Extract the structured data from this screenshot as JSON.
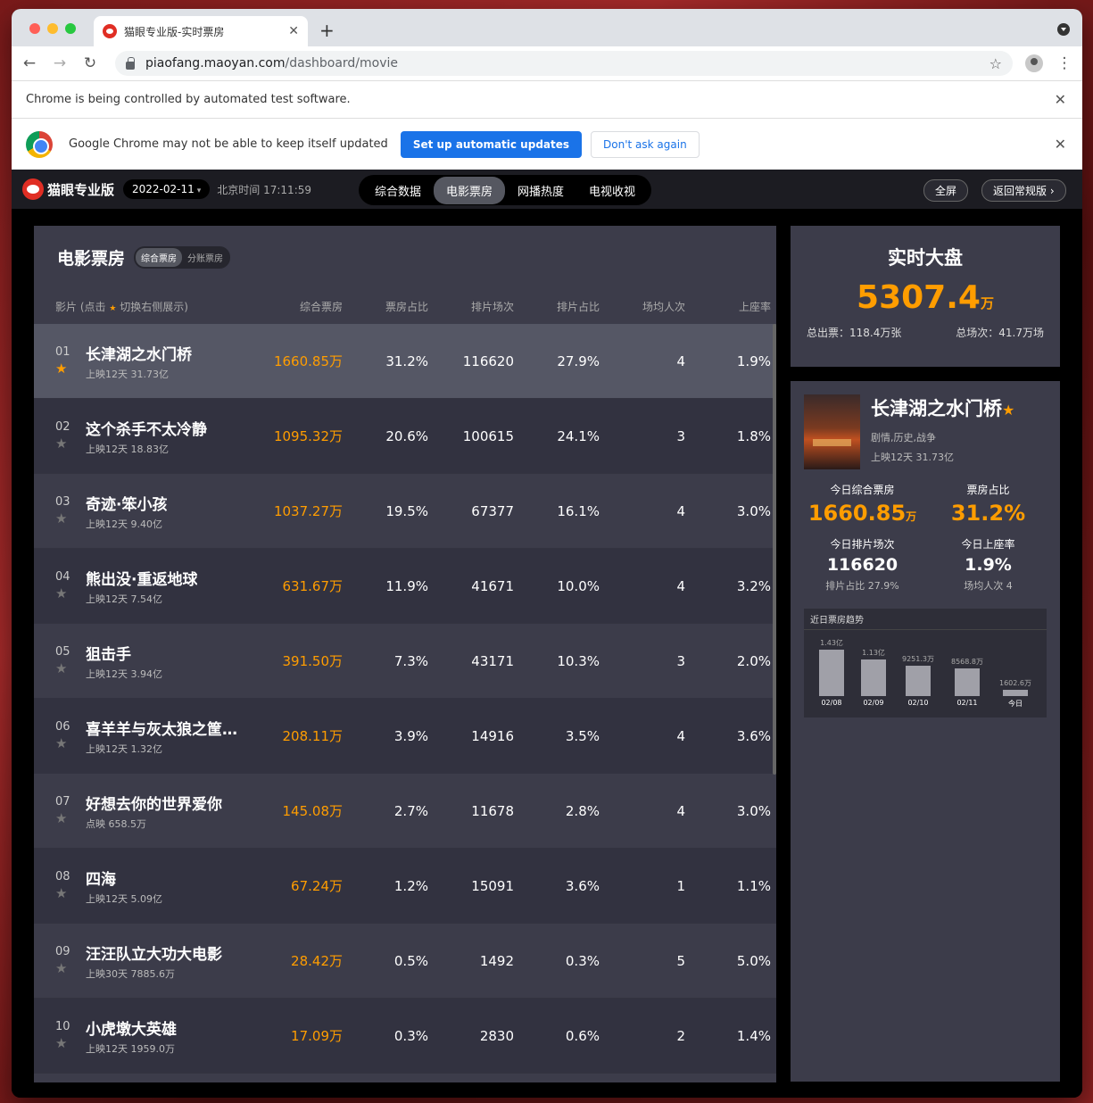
{
  "browser": {
    "tab_title": "猫眼专业版-实时票房",
    "url_host": "piaofang.maoyan.com",
    "url_path": "/dashboard/movie",
    "automation_notice": "Chrome is being controlled by automated test software.",
    "update_notice": "Google Chrome may not be able to keep itself updated",
    "update_button": "Set up automatic updates",
    "dismiss_button": "Don't ask again"
  },
  "header": {
    "logo": "猫眼专业版",
    "date": "2022-02-11",
    "time": "北京时间 17:11:59",
    "nav": [
      "综合数据",
      "电影票房",
      "网播热度",
      "电视收视"
    ],
    "active_nav": 1,
    "fullscreen": "全屏",
    "back": "返回常规版 ›"
  },
  "table": {
    "title": "电影票房",
    "toggle": [
      "综合票房",
      "分账票房"
    ],
    "col_name_pre": "影片 (点击",
    "col_name_post": "切换右侧展示)",
    "columns": [
      "综合票房",
      "票房占比",
      "排片场次",
      "排片占比",
      "场均人次",
      "上座率"
    ],
    "rows": [
      {
        "rank": "01",
        "title": "长津湖之水门桥",
        "sub": "上映12天  31.73亿",
        "box": "1660.85万",
        "share": "31.2%",
        "shows": "116620",
        "show_share": "27.9%",
        "avg": "4",
        "occ": "1.9%"
      },
      {
        "rank": "02",
        "title": "这个杀手不太冷静",
        "sub": "上映12天  18.83亿",
        "box": "1095.32万",
        "share": "20.6%",
        "shows": "100615",
        "show_share": "24.1%",
        "avg": "3",
        "occ": "1.8%"
      },
      {
        "rank": "03",
        "title": "奇迹·笨小孩",
        "sub": "上映12天  9.40亿",
        "box": "1037.27万",
        "share": "19.5%",
        "shows": "67377",
        "show_share": "16.1%",
        "avg": "4",
        "occ": "3.0%"
      },
      {
        "rank": "04",
        "title": "熊出没·重返地球",
        "sub": "上映12天  7.54亿",
        "box": "631.67万",
        "share": "11.9%",
        "shows": "41671",
        "show_share": "10.0%",
        "avg": "4",
        "occ": "3.2%"
      },
      {
        "rank": "05",
        "title": "狙击手",
        "sub": "上映12天  3.94亿",
        "box": "391.50万",
        "share": "7.3%",
        "shows": "43171",
        "show_share": "10.3%",
        "avg": "3",
        "occ": "2.0%"
      },
      {
        "rank": "06",
        "title": "喜羊羊与灰太狼之筐出未来",
        "sub": "上映12天  1.32亿",
        "box": "208.11万",
        "share": "3.9%",
        "shows": "14916",
        "show_share": "3.5%",
        "avg": "4",
        "occ": "3.6%"
      },
      {
        "rank": "07",
        "title": "好想去你的世界爱你",
        "sub": "点映  658.5万",
        "box": "145.08万",
        "share": "2.7%",
        "shows": "11678",
        "show_share": "2.8%",
        "avg": "4",
        "occ": "3.0%"
      },
      {
        "rank": "08",
        "title": "四海",
        "sub": "上映12天  5.09亿",
        "box": "67.24万",
        "share": "1.2%",
        "shows": "15091",
        "show_share": "3.6%",
        "avg": "1",
        "occ": "1.1%"
      },
      {
        "rank": "09",
        "title": "汪汪队立大功大电影",
        "sub": "上映30天  7885.6万",
        "box": "28.42万",
        "share": "0.5%",
        "shows": "1492",
        "show_share": "0.3%",
        "avg": "5",
        "occ": "5.0%"
      },
      {
        "rank": "10",
        "title": "小虎墩大英雄",
        "sub": "上映12天  1959.0万",
        "box": "17.09万",
        "share": "0.3%",
        "shows": "2830",
        "show_share": "0.6%",
        "avg": "2",
        "occ": "1.4%"
      }
    ]
  },
  "realtime": {
    "title": "实时大盘",
    "value": "5307.4",
    "unit": "万",
    "tickets": "总出票：118.4万张",
    "shows": "总场次：41.7万场"
  },
  "detail": {
    "title": "长津湖之水门桥",
    "genre": "剧情,历史,战争",
    "release": "上映12天  31.73亿",
    "m1_label": "今日综合票房",
    "m1_value": "1660.85",
    "m1_unit": "万",
    "m2_label": "票房占比",
    "m2_value": "31.2%",
    "m3_label": "今日排片场次",
    "m3_value": "116620",
    "m3_sub": "排片占比 27.9%",
    "m4_label": "今日上座率",
    "m4_value": "1.9%",
    "m4_sub": "场均人次 4"
  },
  "chart_data": {
    "type": "bar",
    "title": "近日票房趋势",
    "categories": [
      "02/08",
      "02/09",
      "02/10",
      "02/11",
      "今日"
    ],
    "values": [
      14300,
      11300,
      9251.3,
      8568.8,
      1602.6
    ],
    "value_labels": [
      "1.43亿",
      "1.13亿",
      "9251.3万",
      "8568.8万",
      "1602.6万"
    ],
    "ylim": [
      0,
      14300
    ]
  },
  "colors": {
    "accent": "#ff9d00",
    "panel": "#3c3c4a",
    "brand": "#e02e24"
  }
}
